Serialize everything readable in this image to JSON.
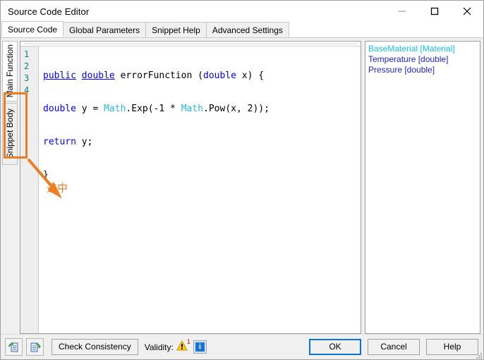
{
  "window": {
    "title": "Source Code Editor",
    "controls": {
      "minimize": "minimize-icon",
      "maximize": "maximize-icon",
      "close": "close-icon"
    }
  },
  "tabs": [
    {
      "label": "Source Code",
      "active": true
    },
    {
      "label": "Global Parameters",
      "active": false
    },
    {
      "label": "Snippet Help",
      "active": false
    },
    {
      "label": "Advanced Settings",
      "active": false
    }
  ],
  "vertical_tabs": [
    {
      "label": "Main Function",
      "active": true
    },
    {
      "label": "Snippet Body",
      "active": false
    }
  ],
  "editor": {
    "line_numbers": [
      "1",
      "2",
      "3",
      "4"
    ],
    "lines": [
      "public double errorFunction (double x) {",
      "double y = Math.Exp(-1 * Math.Pow(x, 2));",
      "return y;",
      "}"
    ]
  },
  "parameters": [
    {
      "label": "BaseMaterial [Material]",
      "color": "#17c3e8"
    },
    {
      "label": "Temperature [double]",
      "color": "#2222dd"
    },
    {
      "label": "Pressure [double]",
      "color": "#2222dd"
    }
  ],
  "bottom_bar": {
    "import_icon": "document-import-icon",
    "export_icon": "document-export-icon",
    "check_consistency_label": "Check Consistency",
    "validity_label": "Validity:",
    "warning_count": "1",
    "warning_icon": "warning-triangle-icon",
    "info_icon": "info-icon"
  },
  "dialog_buttons": {
    "ok": "OK",
    "cancel": "Cancel",
    "help": "Help"
  },
  "annotation": {
    "label": "选中",
    "color": "#f07c22"
  },
  "colors": {
    "accent": "#0a74d4",
    "annotation": "#f07c22",
    "keyword": "#0000ff",
    "type": "#29b8e0",
    "gutter_text": "#0d7f7f"
  }
}
